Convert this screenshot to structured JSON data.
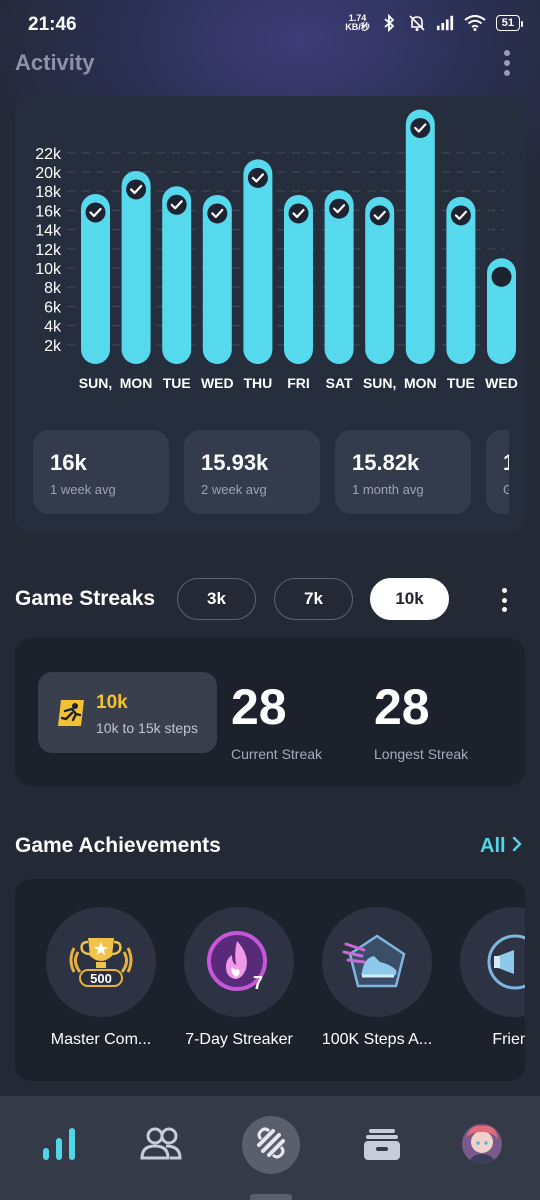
{
  "status_bar": {
    "time": "21:46",
    "net_speed_value": "1.74",
    "net_speed_unit": "KB/秒",
    "battery": "51"
  },
  "header": {
    "title": "Activity"
  },
  "chart_data": {
    "type": "bar",
    "categories": [
      "SUN,",
      "MON",
      "TUE",
      "WED",
      "THU",
      "FRI",
      "SAT",
      "SUN,",
      "MON",
      "TUE",
      "WED"
    ],
    "values": [
      16200,
      18600,
      17000,
      16100,
      19800,
      16100,
      16600,
      15900,
      25000,
      15900,
      9500
    ],
    "goal_met": [
      true,
      true,
      true,
      true,
      true,
      true,
      true,
      true,
      true,
      true,
      false
    ],
    "y_ticks": [
      "2k",
      "4k",
      "6k",
      "8k",
      "10k",
      "12k",
      "14k",
      "16k",
      "18k",
      "20k",
      "22k"
    ],
    "ylim": [
      0,
      24000
    ],
    "grid": true,
    "colors": {
      "bar": "#56d9ec",
      "check": "#1e2331"
    }
  },
  "stats": [
    {
      "value": "16k",
      "label": "1 week avg"
    },
    {
      "value": "15.93k",
      "label": "2 week avg"
    },
    {
      "value": "15.82k",
      "label": "1 month avg"
    },
    {
      "value": "1",
      "label": "G"
    }
  ],
  "streaks": {
    "title": "Game Streaks",
    "tabs": [
      {
        "label": "3k",
        "active": false
      },
      {
        "label": "7k",
        "active": false
      },
      {
        "label": "10k",
        "active": true
      }
    ],
    "badge_title": "10k",
    "badge_sub": "10k to 15k steps",
    "current_value": "28",
    "current_label": "Current Streak",
    "longest_value": "28",
    "longest_label": "Longest Streak"
  },
  "achievements": {
    "title": "Game Achievements",
    "see_all": "All",
    "items": [
      {
        "label": "Master Com...",
        "badge_text": "500",
        "icon": "trophy-icon"
      },
      {
        "label": "7-Day Streaker",
        "badge_text": "7",
        "icon": "flame-icon"
      },
      {
        "label": "100K Steps A...",
        "icon": "sneaker-icon"
      },
      {
        "label": "Friend",
        "icon": "megaphone-icon"
      }
    ]
  },
  "nav": [
    "stats-icon",
    "friends-icon",
    "stepn-home-icon",
    "wallet-icon",
    "profile-avatar"
  ]
}
